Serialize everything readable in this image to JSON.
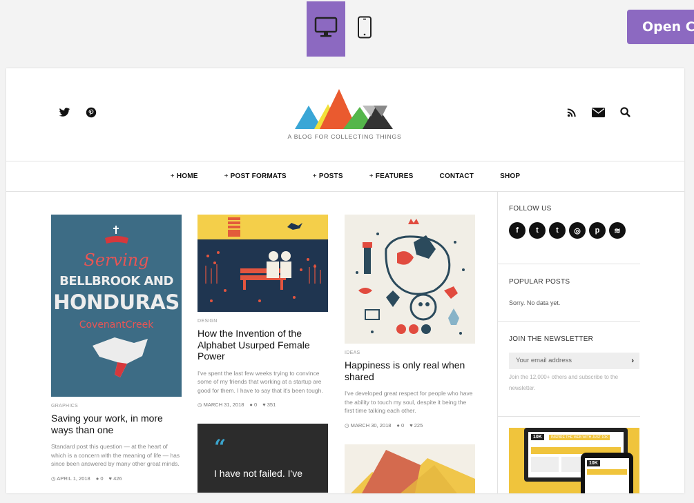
{
  "customizer": {
    "devices": [
      "desktop-icon",
      "mobile-icon"
    ],
    "open_button": "Open Cu",
    "accent": "#8c69c1"
  },
  "site": {
    "tagline": "A BLOG FOR COLLECTING THINGS",
    "social_left": [
      "twitter-icon",
      "pinterest-icon"
    ],
    "social_right": [
      "rss-icon",
      "mail-icon",
      "search-icon"
    ]
  },
  "nav": {
    "plus": "+",
    "items": [
      {
        "label": "HOME",
        "plus": true
      },
      {
        "label": "POST FORMATS",
        "plus": true
      },
      {
        "label": "POSTS",
        "plus": true
      },
      {
        "label": "FEATURES",
        "plus": true
      },
      {
        "label": "CONTACT",
        "plus": false
      },
      {
        "label": "SHOP",
        "plus": false
      }
    ]
  },
  "posts": [
    {
      "image_text": {
        "line1": "Serving",
        "line2": "BELLBROOK AND",
        "line3": "HONDURAS",
        "line4": "CovenantCreek"
      },
      "category": "GRAPHICS",
      "title": "Saving your work, in more ways than one",
      "excerpt": "Standard post this question — at the heart of which is a concern with the meaning of life — has since been answered by many other great minds.",
      "date": "APRIL 1, 2018",
      "comments": "0",
      "likes": "426"
    },
    {
      "category": "DESIGN",
      "title": "How the Invention of the Alphabet Usurped Female Power",
      "excerpt": "I've spent the last few weeks trying to convince some of my friends that working at a startup are good for them. I have to say that it's been tough.",
      "date": "MARCH 31, 2018",
      "comments": "0",
      "likes": "351"
    },
    {
      "category": "IDEAS",
      "title": "Happiness is only real when shared",
      "excerpt": "I've developed great respect for people who have the ability to touch my soul, despite it being the first time talking each other.",
      "date": "MARCH 30, 2018",
      "comments": "0",
      "likes": "225"
    }
  ],
  "quote_card": {
    "mark": "“",
    "text": "I have not failed. I've"
  },
  "sidebar": {
    "follow_heading": "FOLLOW US",
    "follow_icons": [
      {
        "icon": "facebook-icon",
        "glyph": "f"
      },
      {
        "icon": "twitter-icon",
        "glyph": "t"
      },
      {
        "icon": "tumblr-icon",
        "glyph": "t"
      },
      {
        "icon": "instagram-icon",
        "glyph": "◎"
      },
      {
        "icon": "pinterest-icon",
        "glyph": "p"
      },
      {
        "icon": "spotify-icon",
        "glyph": "≋"
      }
    ],
    "popular_heading": "POPULAR POSTS",
    "popular_empty": "Sorry. No data yet.",
    "newsletter_heading": "JOIN THE NEWSLETTER",
    "email_placeholder": "Your email address",
    "email_arrow": "›",
    "newsletter_note": "Join the 12,000+ others and subscribe to the newsletter.",
    "ad_text": "INSPIRE THE WEB WITH JUST 10K",
    "ad_logo": "10K"
  }
}
